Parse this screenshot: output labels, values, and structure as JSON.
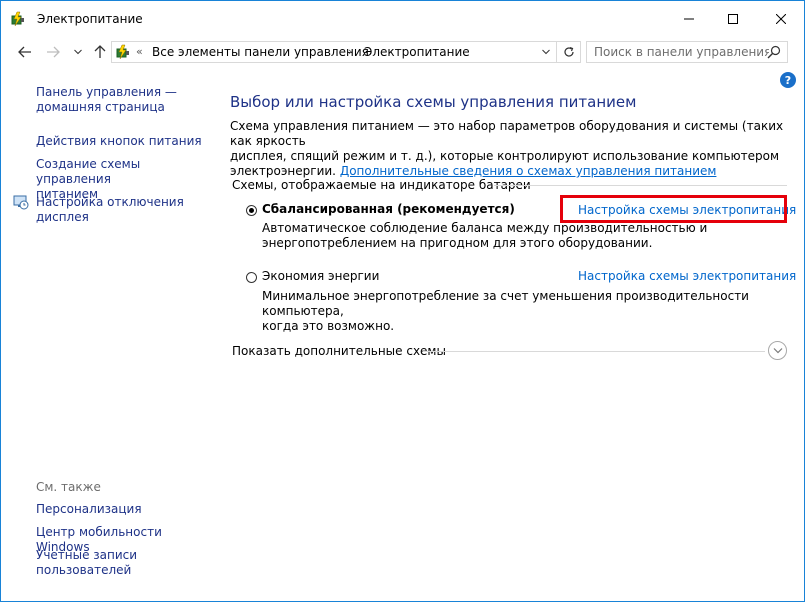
{
  "window": {
    "title": "Электропитание"
  },
  "nav": {
    "breadcrumb_root": "Все элементы панели управления",
    "breadcrumb_current": "Электропитание",
    "search_placeholder": "Поиск в панели управления"
  },
  "sidebar": {
    "home_line1": "Панель управления —",
    "home_line2": "домашняя страница",
    "power_buttons": "Действия кнопок питания",
    "create_plan_line1": "Создание схемы управления",
    "create_plan_line2": "питанием",
    "display_off_line1": "Настройка отключения",
    "display_off_line2": "дисплея",
    "see_also": "См. также",
    "personalization": "Персонализация",
    "mobility_center": "Центр мобильности Windows",
    "accounts_line1": "Учетные записи",
    "accounts_line2": "пользователей"
  },
  "main": {
    "heading": "Выбор или настройка схемы управления питанием",
    "description_line1": "Схема управления питанием — это набор параметров оборудования и системы (таких как яркость",
    "description_line2": "дисплея, спящий режим и т. д.), которые контролируют использование компьютером",
    "description_prefix": "электроэнергии.",
    "description_link": "Дополнительные сведения о схемах управления питанием",
    "group_title": "Схемы, отображаемые на индикаторе батареи",
    "plans": [
      {
        "name": "Сбалансированная (рекомендуется)",
        "link": "Настройка схемы электропитания",
        "desc_line1": "Автоматическое соблюдение баланса между производительностью и",
        "desc_line2": "энергопотреблением на пригодном для этого оборудовании.",
        "selected": true
      },
      {
        "name": "Экономия энергии",
        "link": "Настройка схемы электропитания",
        "desc_line1": "Минимальное энергопотребление за счет уменьшения производительности компьютера,",
        "desc_line2": "когда это возможно.",
        "selected": false
      }
    ],
    "show_more": "Показать дополнительные схемы"
  },
  "colors": {
    "link": "#0066cc",
    "heading": "#1e3287",
    "highlight": "#e5000a",
    "window_border": "#1883d7"
  }
}
